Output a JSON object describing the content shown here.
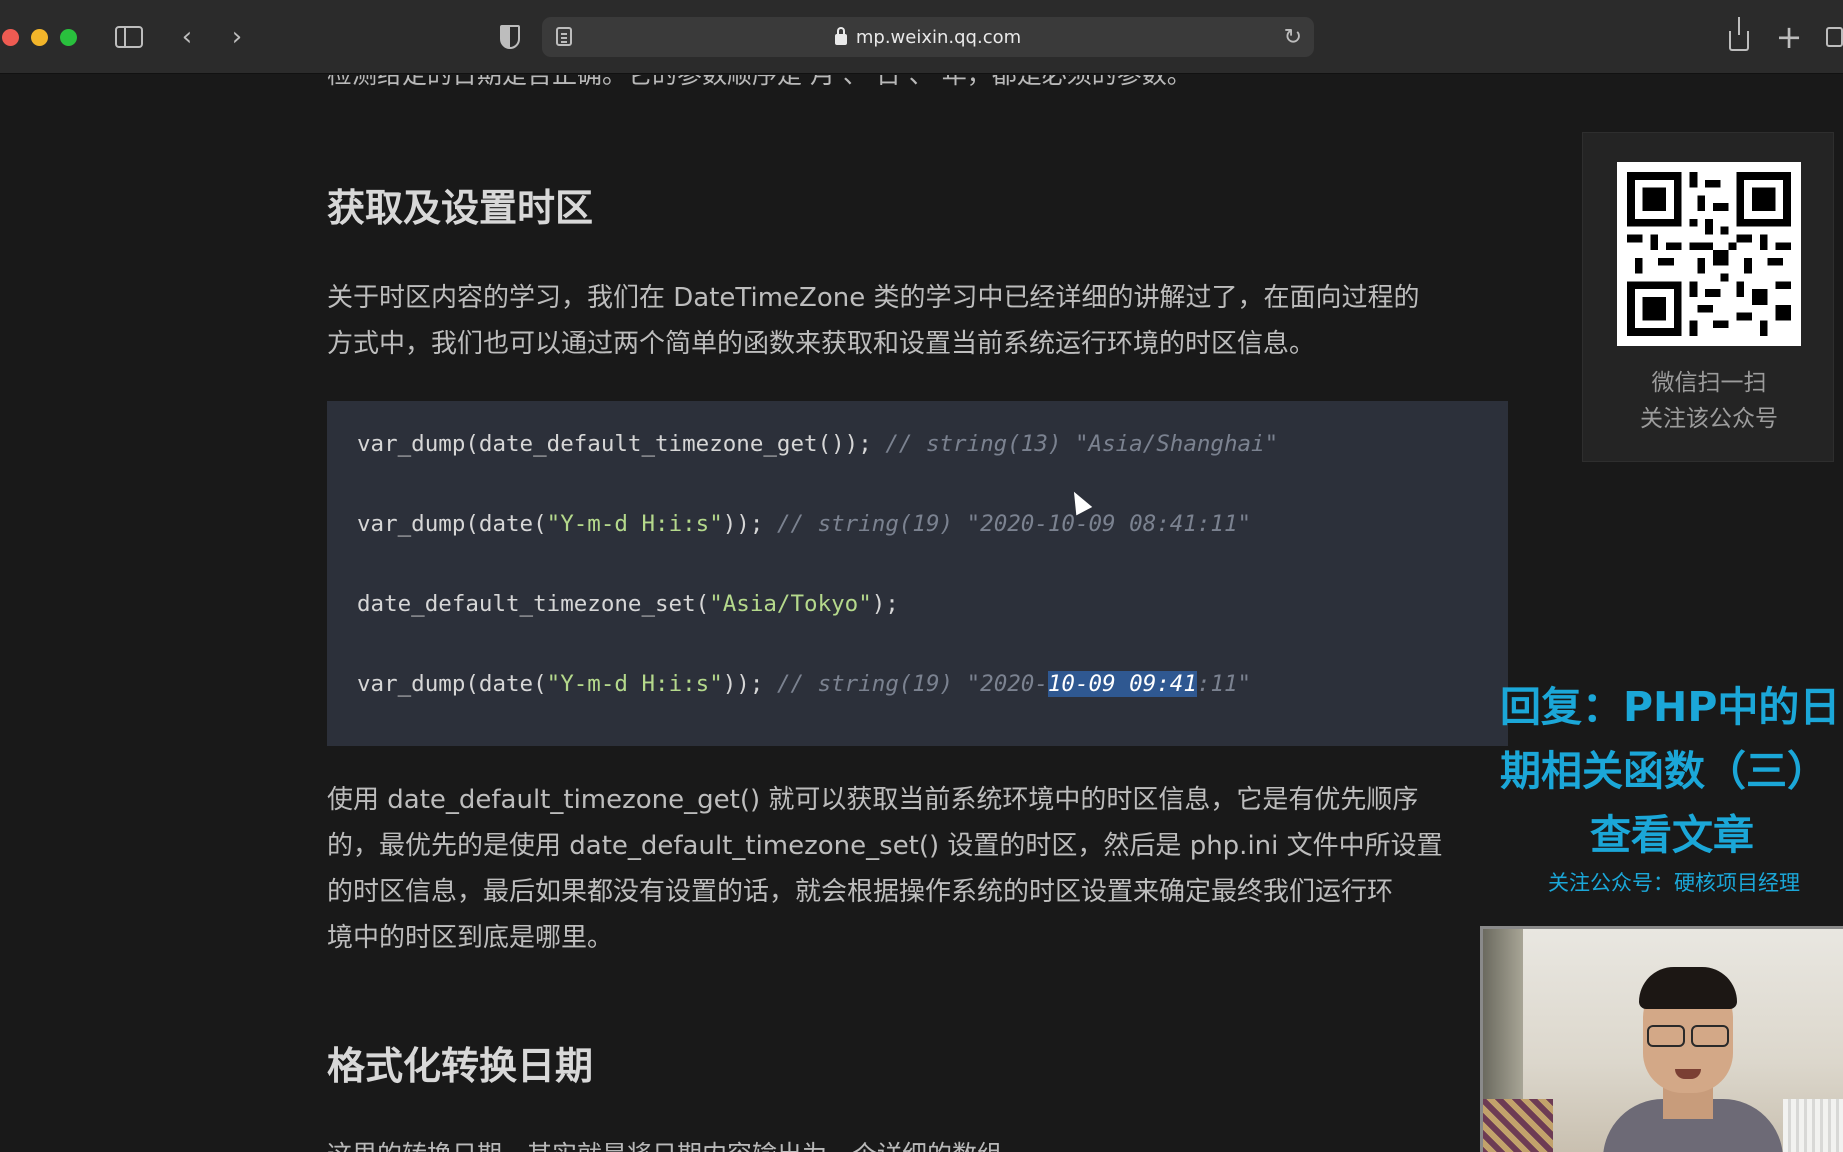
{
  "browser": {
    "url": "mp.weixin.qq.com",
    "icons": [
      "sidebar-icon",
      "chevron-left-icon",
      "chevron-right-icon",
      "shield-icon",
      "reader-icon",
      "lock-icon",
      "reload-icon",
      "share-icon",
      "plus-icon",
      "tabs-icon"
    ]
  },
  "article": {
    "cut_top_line": "检测给定的日期是否正确。它的参数顺序是 月 、 日 、 年，都是必须的参数。",
    "section1_heading": "获取及设置时区",
    "section1_para_line1": "关于时区内容的学习，我们在 DateTimeZone 类的学习中已经详细的讲解过了，在面向过程的",
    "section1_para_line2": "方式中，我们也可以通过两个简单的函数来获取和设置当前系统运行环境的时区信息。",
    "code": {
      "line1_code": "var_dump(date_default_timezone_get()); ",
      "line1_comment": "// string(13) \"Asia/Shanghai\"",
      "line2_pre": "var_dump(date(",
      "line2_str": "\"Y-m-d H:i:s\"",
      "line2_post": ")); ",
      "line2_comment": "// string(19) \"2020-10-09 08:41:11\"",
      "line3_pre": "date_default_timezone_set(",
      "line3_str": "\"Asia/Tokyo\"",
      "line3_post": ");",
      "line4_pre": "var_dump(date(",
      "line4_str": "\"Y-m-d H:i:s\"",
      "line4_post": ")); ",
      "line4_comment_a": "// string(19) \"2020-",
      "line4_comment_highlight": "10-09 09:41",
      "line4_comment_b": ":11\""
    },
    "section1_after_line1": "使用 date_default_timezone_get() 就可以获取当前系统环境中的时区信息，它是有优先顺序",
    "section1_after_line2": "的，最优先的是使用 date_default_timezone_set() 设置的时区，然后是 php.ini 文件中所设置",
    "section1_after_line3": "的时区信息，最后如果都没有设置的话，就会根据操作系统的时区设置来确定最终我们运行环",
    "section1_after_line4": "境中的时区到底是哪里。",
    "section2_heading": "格式化转换日期",
    "cut_bottom_line": "这里的转换日期，其实就是将日期内容输出为一个详细的数组。"
  },
  "qr_card": {
    "caption_line1": "微信扫一扫",
    "caption_line2": "关注该公众号"
  },
  "overlay": {
    "line1": "回复：PHP中的日",
    "line2": "期相关函数（三）",
    "line3": "查看文章",
    "subline": "关注公众号：硬核项目经理"
  }
}
